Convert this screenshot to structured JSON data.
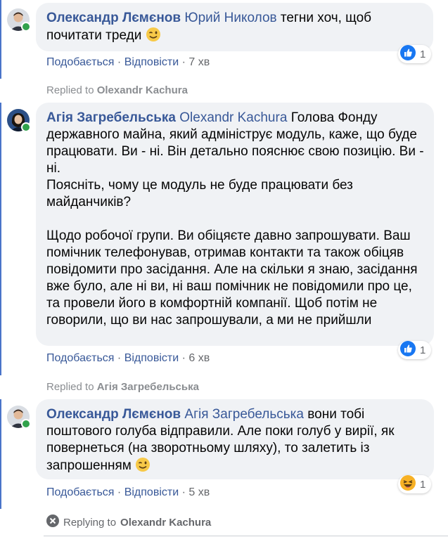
{
  "comments": [
    {
      "author": "Олександр Лємєнов",
      "tag": "Юрий Николов",
      "text_lines": [
        "тегни хоч, щоб",
        "почитати треди"
      ],
      "emoji_icon": "wink-emoji",
      "like_label": "Подобається",
      "reply_label": "Відповісти",
      "time": "7 хв",
      "reaction_icon": "like-icon",
      "reaction_count": "1",
      "avatar_icon": "man-avatar"
    },
    {
      "replied_to_prefix": "Replied to",
      "replied_to_name": "Olexandr Kachura",
      "author": "Агія Загребельська",
      "tag": "Olexandr Kachura",
      "para1": "Голова Фонду державного майна, який адмініструє модуль, каже, що буде працювати. Ви - ні. Він детально пояснює свою позицію. Ви - ні.",
      "para1b": "Поясніть, чому це модуль не буде працювати без майданчиків?",
      "para2": "Щодо робочої групи. Ви обіцяєте давно запрошувати. Ваш помічник телефонував, отримав контакти та також обіцяв повідомити про засідання. Але на скільки я знаю, засідання вже було, але ні ви, ні ваш помічник не повідомили про це, та провели його в комфортній компанії. Щоб потім не говорили, що ви нас запрошували, а ми не прийшли",
      "like_label": "Подобається",
      "reply_label": "Відповісти",
      "time": "6 хв",
      "reaction_icon": "like-icon",
      "reaction_count": "1",
      "avatar_icon": "woman-avatar"
    },
    {
      "replied_to_prefix": "Replied to",
      "replied_to_name": "Агія Загребельська",
      "author": "Олександр Лємєнов",
      "tag": "Агія Загребельська",
      "text": "вони тобі поштового голуба відправили. Але поки голуб у вирії, як повернеться (на зворотньому шляху), то залетить із запрошенням",
      "emoji_icon": "wink-emoji",
      "like_label": "Подобається",
      "reply_label": "Відповісти",
      "time": "5 хв",
      "reaction_icon": "haha-icon",
      "reaction_count": "1",
      "avatar_icon": "man-avatar"
    }
  ],
  "separator": "·",
  "replying": {
    "prefix": "Replying to",
    "name": "Olexandr Kachura",
    "icon": "close-icon"
  },
  "colors": {
    "link": "#385898",
    "bubble": "#f0f2f5",
    "muted": "#65676b",
    "online": "#31a24c",
    "like": "#1877f2",
    "haha": "#f7b125"
  }
}
